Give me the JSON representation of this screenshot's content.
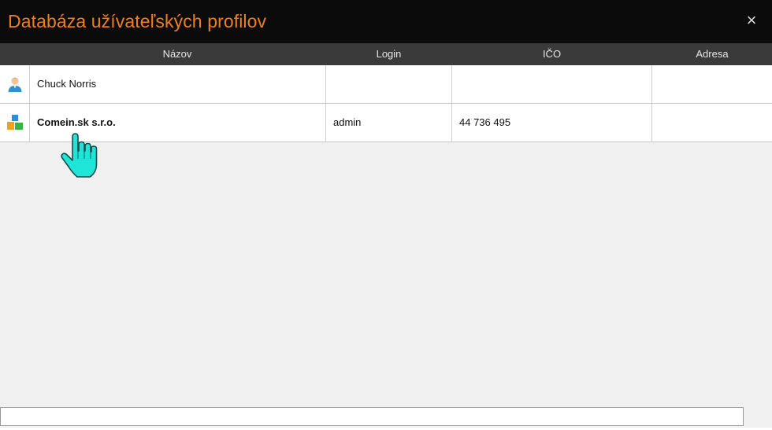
{
  "window": {
    "title": "Databáza užívateľských profilov",
    "close_label": "×"
  },
  "table": {
    "columns": [
      "Názov",
      "Login",
      "IČO",
      "Adresa"
    ],
    "rows": [
      {
        "icon": "person-icon",
        "nazov": "Chuck Norris",
        "login": "",
        "ico": "",
        "adresa": "",
        "bold": false
      },
      {
        "icon": "company-blocks-icon",
        "nazov": "Comein.sk s.r.o.",
        "login": "admin",
        "ico": "44 736 495",
        "adresa": "",
        "bold": true
      }
    ]
  },
  "search": {
    "value": "",
    "placeholder": ""
  },
  "colors": {
    "title_orange": "#f07f16",
    "titlebar_bg": "#0b0b0b",
    "header_bg": "#3a3a3a",
    "cursor_cyan": "#1fe5d8"
  },
  "cursor": {
    "icon": "hand-pointer-icon"
  }
}
